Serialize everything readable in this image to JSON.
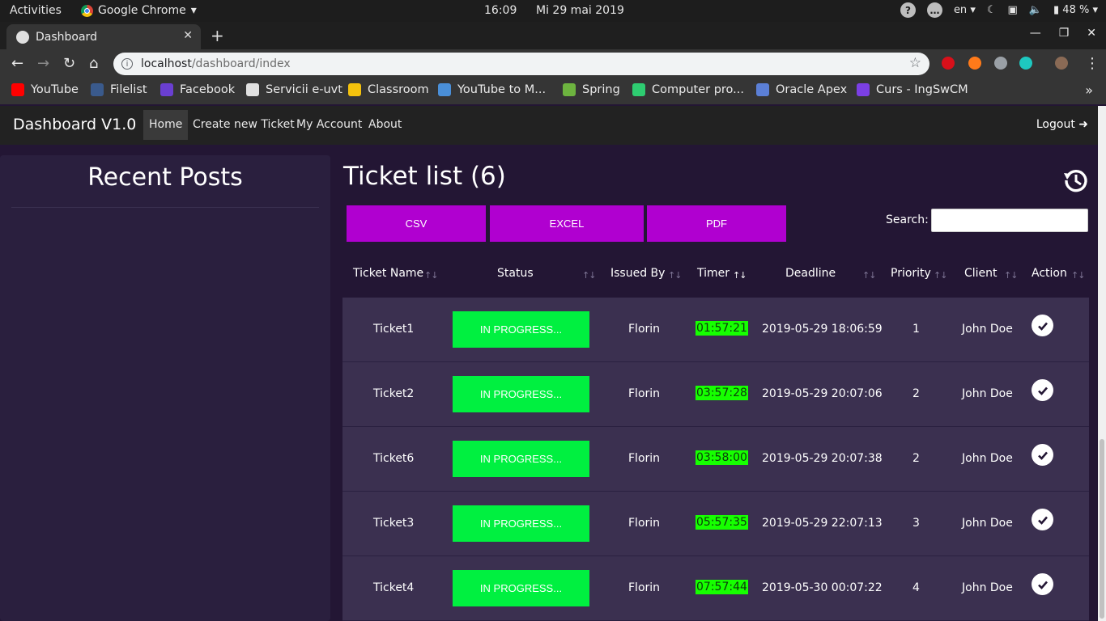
{
  "system_bar": {
    "activities": "Activities",
    "app_name": "Google Chrome",
    "time": "16:09",
    "date": "Mi 29 mai 2019",
    "language": "en",
    "battery": "48 %"
  },
  "browser": {
    "tab_title": "Dashboard",
    "url_host": "localhost",
    "url_path": "/dashboard/index",
    "bookmarks": [
      {
        "label": "YouTube",
        "icon": "youtube-icon",
        "color": "#ff0000"
      },
      {
        "label": "Filelist",
        "icon": "filelist-icon",
        "color": "#3a5a8c"
      },
      {
        "label": "Facebook",
        "icon": "facebook-icon",
        "color": "#6a3fd1"
      },
      {
        "label": "Servicii e-uvt",
        "icon": "globe-icon",
        "color": "#e0e0e0"
      },
      {
        "label": "Classroom",
        "icon": "classroom-icon",
        "color": "#f4c20d"
      },
      {
        "label": "YouTube to M...",
        "icon": "download-icon",
        "color": "#4a8fd8"
      },
      {
        "label": "Spring",
        "icon": "spring-icon",
        "color": "#6db33f"
      },
      {
        "label": "Computer pro...",
        "icon": "hexagon-icon",
        "color": "#2ecc71"
      },
      {
        "label": "Oracle Apex",
        "icon": "apex-icon",
        "color": "#5b7fd6"
      },
      {
        "label": "Curs - IngSwCM",
        "icon": "course-icon",
        "color": "#7b3fe4"
      }
    ]
  },
  "navbar": {
    "brand": "Dashboard V1.0",
    "links": [
      {
        "label": "Home",
        "active": true
      },
      {
        "label": "Create new Ticket",
        "active": false
      },
      {
        "label": "My Account",
        "active": false
      },
      {
        "label": "About",
        "active": false
      }
    ],
    "logout": "Logout"
  },
  "sidebar": {
    "title": "Recent Posts"
  },
  "main": {
    "title": "Ticket list (6)",
    "export_buttons": [
      "CSV",
      "EXCEL",
      "PDF"
    ],
    "search_label": "Search:",
    "search_value": "",
    "columns": [
      "Ticket Name",
      "Status",
      "Issued By",
      "Timer",
      "Deadline",
      "Priority",
      "Client",
      "Action"
    ],
    "sorted_column": "Timer",
    "rows": [
      {
        "name": "Ticket1",
        "status": "IN PROGRESS...",
        "issued_by": "Florin",
        "timer": "01:57:21",
        "deadline": "2019-05-29 18:06:59",
        "priority": "1",
        "client": "John Doe"
      },
      {
        "name": "Ticket2",
        "status": "IN PROGRESS...",
        "issued_by": "Florin",
        "timer": "03:57:28",
        "deadline": "2019-05-29 20:07:06",
        "priority": "2",
        "client": "John Doe"
      },
      {
        "name": "Ticket6",
        "status": "IN PROGRESS...",
        "issued_by": "Florin",
        "timer": "03:58:00",
        "deadline": "2019-05-29 20:07:38",
        "priority": "2",
        "client": "John Doe"
      },
      {
        "name": "Ticket3",
        "status": "IN PROGRESS...",
        "issued_by": "Florin",
        "timer": "05:57:35",
        "deadline": "2019-05-29 22:07:13",
        "priority": "3",
        "client": "John Doe"
      },
      {
        "name": "Ticket4",
        "status": "IN PROGRESS...",
        "issued_by": "Florin",
        "timer": "07:57:44",
        "deadline": "2019-05-30 00:07:22",
        "priority": "4",
        "client": "John Doe"
      }
    ]
  },
  "colors": {
    "background": "#231634",
    "sidebar": "#2a1f3e",
    "row": "#3b3050",
    "export_button": "#b000d0",
    "status_button": "#00f040",
    "timer_highlight": "#16ff00"
  }
}
